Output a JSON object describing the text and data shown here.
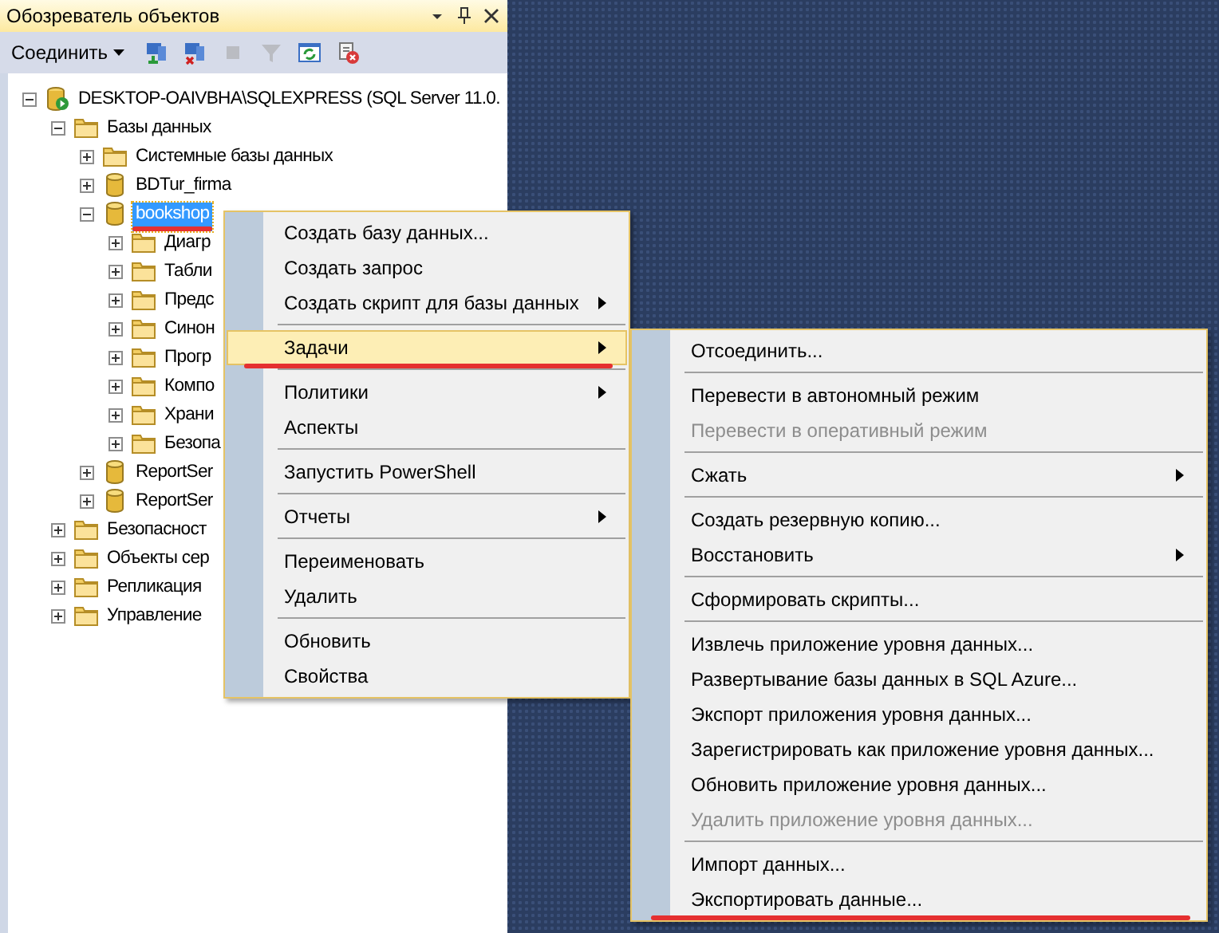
{
  "panel": {
    "title": "Обозреватель объектов",
    "connect_label": "Соединить",
    "toolbar": [
      {
        "kind": "connect",
        "disabled": false
      },
      {
        "kind": "disconnect",
        "disabled": false
      },
      {
        "kind": "stop",
        "disabled": true
      },
      {
        "kind": "filter",
        "disabled": true
      },
      {
        "kind": "refresh",
        "disabled": false
      },
      {
        "kind": "script",
        "disabled": false
      }
    ]
  },
  "tree": [
    {
      "label": "DESKTOP-OAIVBHA\\SQLEXPRESS (SQL Server 11.0.",
      "kind": "server",
      "expanded": true,
      "selected": false,
      "underlined": false,
      "children": [
        {
          "label": "Базы данных",
          "kind": "folder",
          "expanded": true,
          "selected": false,
          "underlined": false,
          "children": [
            {
              "label": "Системные базы данных",
              "kind": "folder",
              "expanded": false,
              "selected": false,
              "underlined": false
            },
            {
              "label": "BDTur_firma",
              "kind": "database",
              "expanded": false,
              "selected": false,
              "underlined": false
            },
            {
              "label": "bookshop",
              "kind": "database",
              "expanded": true,
              "selected": true,
              "underlined": true,
              "children": [
                {
                  "label": "Диагр",
                  "kind": "folder",
                  "expanded": false,
                  "selected": false,
                  "underlined": false
                },
                {
                  "label": "Табли",
                  "kind": "folder",
                  "expanded": false,
                  "selected": false,
                  "underlined": false
                },
                {
                  "label": "Предс",
                  "kind": "folder",
                  "expanded": false,
                  "selected": false,
                  "underlined": false
                },
                {
                  "label": "Синон",
                  "kind": "folder",
                  "expanded": false,
                  "selected": false,
                  "underlined": false
                },
                {
                  "label": "Прогр",
                  "kind": "folder",
                  "expanded": false,
                  "selected": false,
                  "underlined": false
                },
                {
                  "label": "Компо",
                  "kind": "folder",
                  "expanded": false,
                  "selected": false,
                  "underlined": false
                },
                {
                  "label": "Храни",
                  "kind": "folder",
                  "expanded": false,
                  "selected": false,
                  "underlined": false
                },
                {
                  "label": "Безопа",
                  "kind": "folder",
                  "expanded": false,
                  "selected": false,
                  "underlined": false
                }
              ]
            },
            {
              "label": "ReportSer",
              "kind": "database",
              "expanded": false,
              "selected": false,
              "underlined": false
            },
            {
              "label": "ReportSer",
              "kind": "database",
              "expanded": false,
              "selected": false,
              "underlined": false
            }
          ]
        },
        {
          "label": "Безопасност",
          "kind": "folder",
          "expanded": false,
          "selected": false,
          "underlined": false
        },
        {
          "label": "Объекты сер",
          "kind": "folder",
          "expanded": false,
          "selected": false,
          "underlined": false
        },
        {
          "label": "Репликация",
          "kind": "folder",
          "expanded": false,
          "selected": false,
          "underlined": false
        },
        {
          "label": "Управление",
          "kind": "folder",
          "expanded": false,
          "selected": false,
          "underlined": false
        }
      ]
    }
  ],
  "context_menu": {
    "items": [
      {
        "kind": "item",
        "label": "Создать базу данных...",
        "submenu": false,
        "selected": false,
        "disabled": false,
        "underlined": false
      },
      {
        "kind": "item",
        "label": "Создать запрос",
        "submenu": false,
        "selected": false,
        "disabled": false,
        "underlined": false
      },
      {
        "kind": "item",
        "label": "Создать скрипт для базы данных",
        "submenu": true,
        "selected": false,
        "disabled": false,
        "underlined": false
      },
      {
        "kind": "separator"
      },
      {
        "kind": "item",
        "label": "Задачи",
        "submenu": true,
        "selected": true,
        "disabled": false,
        "underlined": true
      },
      {
        "kind": "separator"
      },
      {
        "kind": "item",
        "label": "Политики",
        "submenu": true,
        "selected": false,
        "disabled": false,
        "underlined": false
      },
      {
        "kind": "item",
        "label": "Аспекты",
        "submenu": false,
        "selected": false,
        "disabled": false,
        "underlined": false
      },
      {
        "kind": "separator"
      },
      {
        "kind": "item",
        "label": "Запустить PowerShell",
        "submenu": false,
        "selected": false,
        "disabled": false,
        "underlined": false
      },
      {
        "kind": "separator"
      },
      {
        "kind": "item",
        "label": "Отчеты",
        "submenu": true,
        "selected": false,
        "disabled": false,
        "underlined": false
      },
      {
        "kind": "separator"
      },
      {
        "kind": "item",
        "label": "Переименовать",
        "submenu": false,
        "selected": false,
        "disabled": false,
        "underlined": false
      },
      {
        "kind": "item",
        "label": "Удалить",
        "submenu": false,
        "selected": false,
        "disabled": false,
        "underlined": false
      },
      {
        "kind": "separator"
      },
      {
        "kind": "item",
        "label": "Обновить",
        "submenu": false,
        "selected": false,
        "disabled": false,
        "underlined": false
      },
      {
        "kind": "item",
        "label": "Свойства",
        "submenu": false,
        "selected": false,
        "disabled": false,
        "underlined": false
      }
    ]
  },
  "submenu": {
    "items": [
      {
        "kind": "item",
        "label": "Отсоединить...",
        "submenu": false,
        "selected": false,
        "disabled": false,
        "underlined": false
      },
      {
        "kind": "separator"
      },
      {
        "kind": "item",
        "label": "Перевести в автономный режим",
        "submenu": false,
        "selected": false,
        "disabled": false,
        "underlined": false
      },
      {
        "kind": "item",
        "label": "Перевести в оперативный режим",
        "submenu": false,
        "selected": false,
        "disabled": true,
        "underlined": false
      },
      {
        "kind": "separator"
      },
      {
        "kind": "item",
        "label": "Сжать",
        "submenu": true,
        "selected": false,
        "disabled": false,
        "underlined": false
      },
      {
        "kind": "separator"
      },
      {
        "kind": "item",
        "label": "Создать резервную копию...",
        "submenu": false,
        "selected": false,
        "disabled": false,
        "underlined": false
      },
      {
        "kind": "item",
        "label": "Восстановить",
        "submenu": true,
        "selected": false,
        "disabled": false,
        "underlined": false
      },
      {
        "kind": "separator"
      },
      {
        "kind": "item",
        "label": "Сформировать скрипты...",
        "submenu": false,
        "selected": false,
        "disabled": false,
        "underlined": false
      },
      {
        "kind": "separator"
      },
      {
        "kind": "item",
        "label": "Извлечь приложение уровня данных...",
        "submenu": false,
        "selected": false,
        "disabled": false,
        "underlined": false
      },
      {
        "kind": "item",
        "label": "Развертывание базы данных в SQL Azure...",
        "submenu": false,
        "selected": false,
        "disabled": false,
        "underlined": false
      },
      {
        "kind": "item",
        "label": "Экспорт приложения уровня данных...",
        "submenu": false,
        "selected": false,
        "disabled": false,
        "underlined": false
      },
      {
        "kind": "item",
        "label": "Зарегистрировать как приложение уровня данных...",
        "submenu": false,
        "selected": false,
        "disabled": false,
        "underlined": false
      },
      {
        "kind": "item",
        "label": "Обновить приложение уровня данных...",
        "submenu": false,
        "selected": false,
        "disabled": false,
        "underlined": false
      },
      {
        "kind": "item",
        "label": "Удалить приложение уровня данных...",
        "submenu": false,
        "selected": false,
        "disabled": true,
        "underlined": false
      },
      {
        "kind": "separator"
      },
      {
        "kind": "item",
        "label": "Импорт данных...",
        "submenu": false,
        "selected": false,
        "disabled": false,
        "underlined": false
      },
      {
        "kind": "item",
        "label": "Экспортировать данные...",
        "submenu": false,
        "selected": false,
        "disabled": false,
        "underlined": true
      }
    ]
  }
}
